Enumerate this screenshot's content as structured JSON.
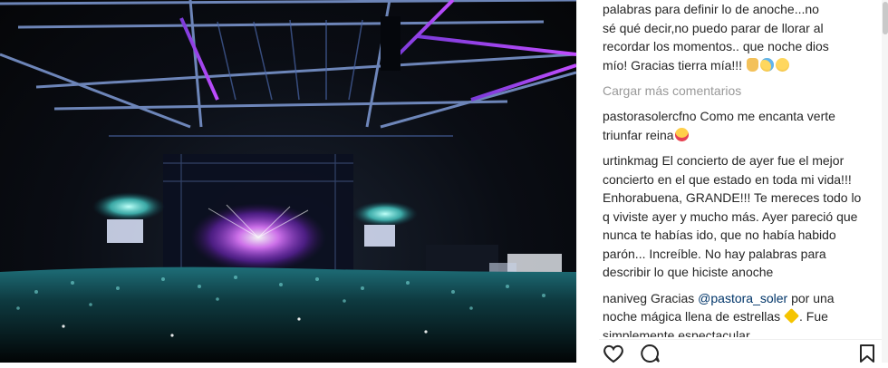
{
  "photo": {
    "icon": "concert-photo",
    "colors": {
      "sky": "#0a0d14",
      "stage_magenta": "#d94cff",
      "screen_cyan": "#4fe8e0",
      "truss": "#8fa7d8"
    }
  },
  "comments": {
    "caption_lines": [
      "palabras para definir lo de anoche...no",
      "sé qué decir,no puedo parar de llorar al",
      "recordar los momentos.. que noche dios",
      "mío! Gracias tierra mía!!! "
    ],
    "load_more": "Cargar más comentarios",
    "items": [
      {
        "user": "pastorasolercfno",
        "text": "Como me encanta verte triunfar reina"
      },
      {
        "user": "urtinkmag",
        "text": "El concierto de ayer fue el mejor concierto en el que estado en toda mi vida!!! Enhorabuena, GRANDE!!! Te mereces todo lo q viviste ayer y mucho más. Ayer pareció que nunca te habías ido, que no había habido parón... Increíble. No hay palabras para describir lo que hiciste anoche"
      },
      {
        "user": "naniveg",
        "pre": "Gracias ",
        "mention": "@pastora_soler",
        "post": " por una noche mágica llena de estrellas",
        "tail": ". Fue simplemente espectacular"
      }
    ]
  },
  "actions": {
    "like_icon": "heart-icon",
    "comment_icon": "comment-icon",
    "save_icon": "bookmark-icon"
  }
}
